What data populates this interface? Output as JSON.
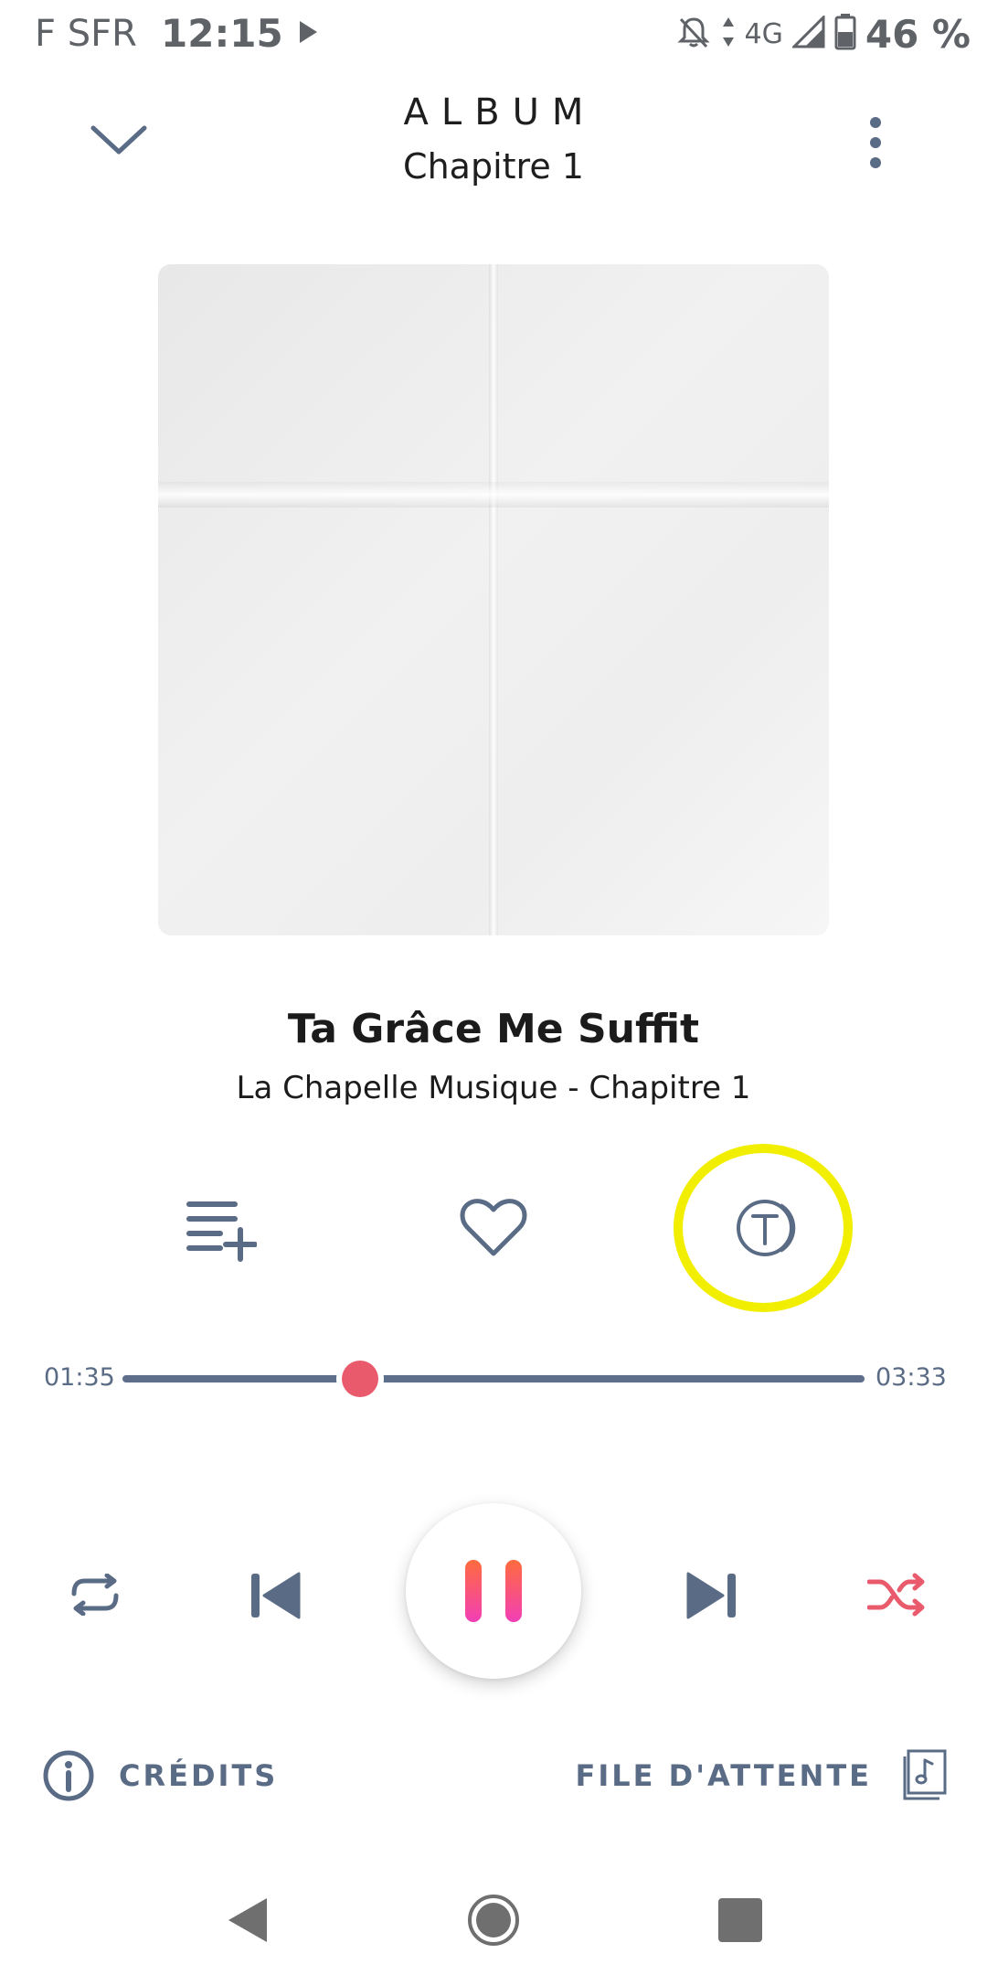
{
  "status_bar": {
    "carrier": "F SFR",
    "time": "12:15",
    "network": "4G",
    "battery": "46 %"
  },
  "header": {
    "title": "ALBUM",
    "subtitle": "Chapitre 1"
  },
  "track": {
    "title": "Ta Grâce Me Suffit",
    "artist": "La Chapelle Musique - Chapitre 1"
  },
  "progress": {
    "current": "01:35",
    "total": "03:33",
    "fraction": 0.32
  },
  "footer": {
    "credits_label": "CRÉDITS",
    "queue_label": "FILE D'ATTENTE"
  },
  "colors": {
    "accent": "#e85a6c",
    "icon": "#5a6b85",
    "highlight": "#f2ee00",
    "play_gradient_top": "#ff6b3d",
    "play_gradient_bottom": "#f23fb6"
  },
  "icons": {
    "header_left": "chevron-down-icon",
    "header_right": "more-vertical-icon",
    "add_to_playlist": "playlist-add-icon",
    "favorite": "heart-icon",
    "lyrics": "lyrics-t-icon",
    "repeat": "repeat-icon",
    "previous": "skip-previous-icon",
    "play_pause": "pause-icon",
    "next": "skip-next-icon",
    "shuffle": "shuffle-icon",
    "credits": "info-icon",
    "queue": "queue-music-icon"
  }
}
